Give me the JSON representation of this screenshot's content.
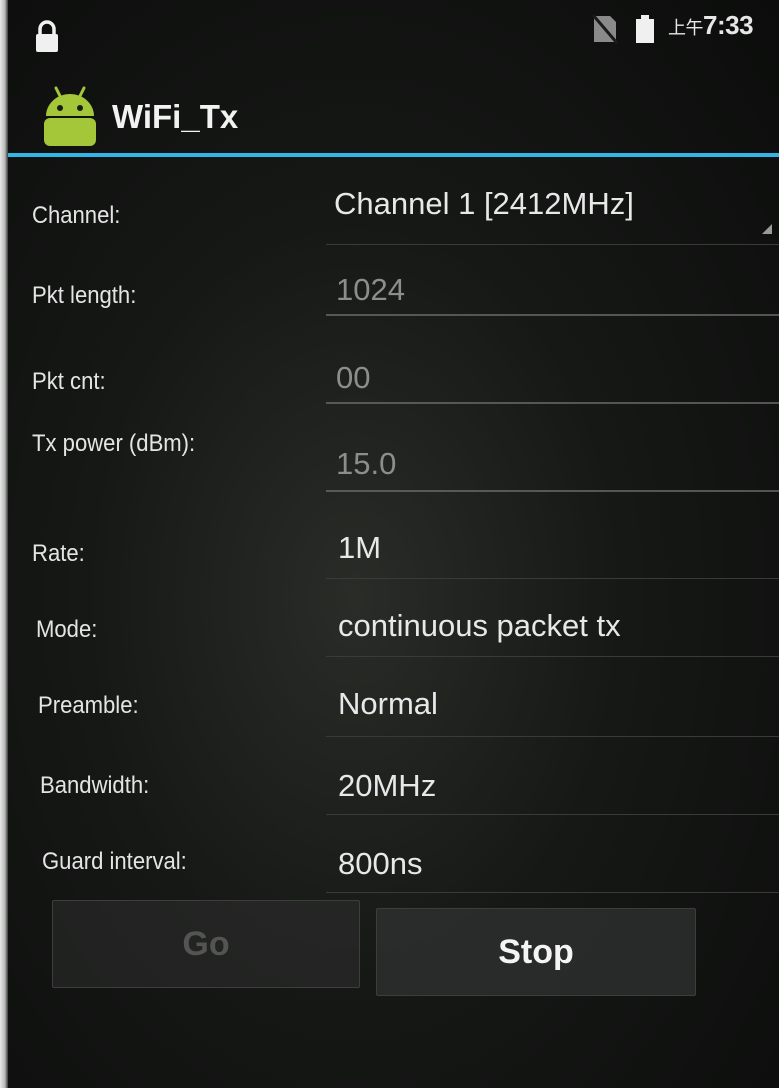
{
  "status_bar": {
    "ampm": "上午",
    "time": "7:33",
    "icons": [
      "lock-icon",
      "no-sim-icon",
      "battery-icon"
    ]
  },
  "action_bar": {
    "title": "WiFi_Tx",
    "icon": "android-icon"
  },
  "form": {
    "channel": {
      "label": "Channel:",
      "value": "Channel 1 [2412MHz]"
    },
    "pkt_length": {
      "label": "Pkt length:",
      "value": "1024"
    },
    "pkt_cnt": {
      "label": "Pkt cnt:",
      "value": "00"
    },
    "tx_power": {
      "label": "Tx power (dBm):",
      "value": "15.0"
    },
    "rate": {
      "label": "Rate:",
      "value": "1M"
    },
    "mode": {
      "label": "Mode:",
      "value": "continuous packet tx"
    },
    "preamble": {
      "label": "Preamble:",
      "value": "Normal"
    },
    "bandwidth": {
      "label": "Bandwidth:",
      "value": "20MHz"
    },
    "guard_interval": {
      "label": "Guard interval:",
      "value": "800ns"
    }
  },
  "buttons": {
    "go": "Go",
    "stop": "Stop"
  },
  "colors": {
    "accent": "#33b5e5",
    "android_green": "#a4c639"
  }
}
